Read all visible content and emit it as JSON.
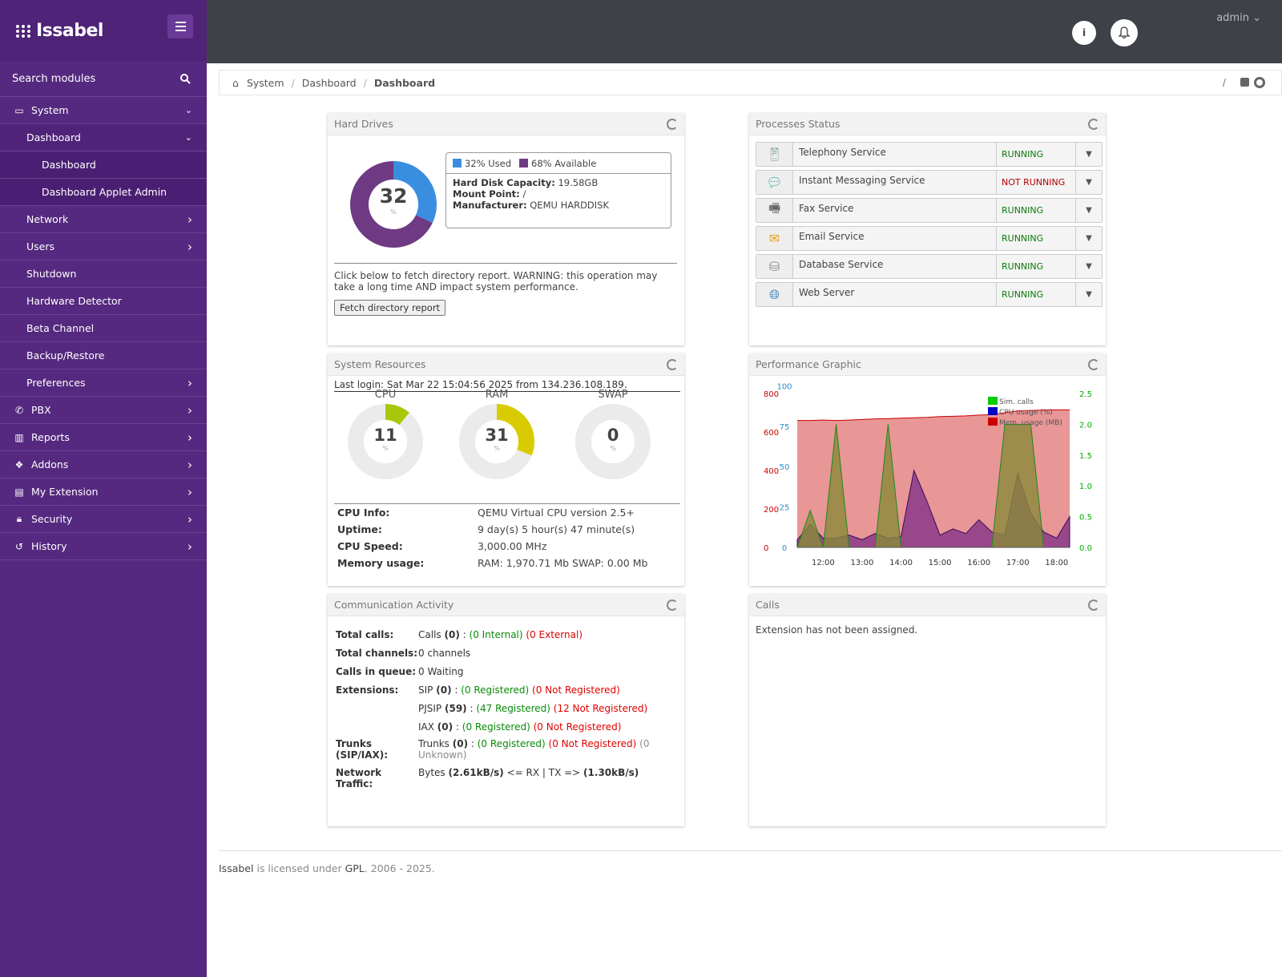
{
  "app": {
    "name": "Issabel",
    "user": "admin"
  },
  "sidebar": {
    "search": "Search modules",
    "items": [
      {
        "label": "System",
        "icon": "laptop-icon",
        "level": 0,
        "chevron": "down"
      },
      {
        "label": "Dashboard",
        "level": 1,
        "chevron": "down"
      },
      {
        "label": "Dashboard",
        "level": 2
      },
      {
        "label": "Dashboard Applet Admin",
        "level": 2
      },
      {
        "label": "Network",
        "level": 1,
        "chevron": "right"
      },
      {
        "label": "Users",
        "level": 1,
        "chevron": "right"
      },
      {
        "label": "Shutdown",
        "level": 1
      },
      {
        "label": "Hardware Detector",
        "level": 1
      },
      {
        "label": "Beta Channel",
        "level": 1
      },
      {
        "label": "Backup/Restore",
        "level": 1
      },
      {
        "label": "Preferences",
        "level": 1,
        "chevron": "right"
      },
      {
        "label": "PBX",
        "icon": "phone-icon",
        "level": 0,
        "chevron": "right"
      },
      {
        "label": "Reports",
        "icon": "bar-chart-icon",
        "level": 0,
        "chevron": "right"
      },
      {
        "label": "Addons",
        "icon": "cubes-icon",
        "level": 0,
        "chevron": "right"
      },
      {
        "label": "My Extension",
        "icon": "id-card-icon",
        "level": 0,
        "chevron": "right"
      },
      {
        "label": "Security",
        "icon": "lock-icon",
        "level": 0,
        "chevron": "right"
      },
      {
        "label": "History",
        "icon": "history-icon",
        "level": 0,
        "chevron": "right"
      }
    ]
  },
  "breadcrumb": [
    "System",
    "Dashboard",
    "Dashboard"
  ],
  "hard_drives": {
    "title": "Hard Drives",
    "used_percent": 32,
    "percent_sign": "%",
    "legend_used": "32% Used",
    "legend_available": "68% Available",
    "capacity_label": "Hard Disk Capacity:",
    "capacity": "19.58GB",
    "mount_label": "Mount Point:",
    "mount": "/",
    "manufacturer_label": "Manufacturer:",
    "manufacturer": "QEMU HARDDISK",
    "warning": "Click below to fetch directory report. WARNING: this operation may take a long time AND impact system performance.",
    "fetch_button": "Fetch directory report",
    "colors": {
      "used": "#3a8ee0",
      "available": "#6f3a84"
    }
  },
  "processes": {
    "title": "Processes Status",
    "items": [
      {
        "name": "Telephony Service",
        "status": "RUNNING",
        "running": true,
        "icon": "phone-device-icon"
      },
      {
        "name": "Instant Messaging Service",
        "status": "NOT RUNNING",
        "running": false,
        "icon": "chat-bubbles-icon"
      },
      {
        "name": "Fax Service",
        "status": "RUNNING",
        "running": true,
        "icon": "fax-icon"
      },
      {
        "name": "Email Service",
        "status": "RUNNING",
        "running": true,
        "icon": "envelope-icon"
      },
      {
        "name": "Database Service",
        "status": "RUNNING",
        "running": true,
        "icon": "database-icon"
      },
      {
        "name": "Web Server",
        "status": "RUNNING",
        "running": true,
        "icon": "globe-icon"
      }
    ]
  },
  "system_resources": {
    "title": "System Resources",
    "last_login": "Last login: Sat Mar 22 15:04:56 2025 from 134.236.108.189.",
    "gauges": [
      {
        "label": "CPU",
        "value": 11,
        "color": "#a8c70a"
      },
      {
        "label": "RAM",
        "value": 31,
        "color": "#d8cc00"
      },
      {
        "label": "SWAP",
        "value": 0,
        "color": "#d8cc00"
      }
    ],
    "percent_sign": "%",
    "info": [
      {
        "k": "CPU Info:",
        "v": "QEMU Virtual CPU version 2.5+"
      },
      {
        "k": "Uptime:",
        "v": "9 day(s) 5 hour(s) 47 minute(s)"
      },
      {
        "k": "CPU Speed:",
        "v": "3,000.00 MHz"
      },
      {
        "k": "Memory usage:",
        "v": "RAM: 1,970.71 Mb SWAP: 0.00 Mb"
      }
    ]
  },
  "performance": {
    "title": "Performance Graphic"
  },
  "chart_data": {
    "type": "area",
    "x": [
      "11:20",
      "11:40",
      "12:00",
      "12:20",
      "12:40",
      "13:00",
      "13:20",
      "13:40",
      "14:00",
      "14:20",
      "14:40",
      "15:00",
      "15:20",
      "15:40",
      "16:00",
      "16:20",
      "16:40",
      "17:00",
      "17:20",
      "17:40",
      "18:00",
      "18:20"
    ],
    "x_ticks": [
      "12:00",
      "13:00",
      "14:00",
      "15:00",
      "16:00",
      "17:00",
      "18:00"
    ],
    "y_left_ticks": [
      0,
      200,
      400,
      600,
      800
    ],
    "y_left_blue_ticks": [
      0,
      25,
      50,
      75,
      100
    ],
    "y_right_ticks": [
      "0.0",
      "0.5",
      "1.0",
      "1.5",
      "2.0",
      "2.5"
    ],
    "ylim_left": [
      0,
      800
    ],
    "ylim_blue": [
      0,
      100
    ],
    "ylim_right": [
      0,
      2.5
    ],
    "legend_position": "top-right",
    "series": [
      {
        "name": "Sim. calls",
        "color": "#00cc00",
        "axis": "right",
        "values": [
          0,
          0.6,
          0,
          2.0,
          0,
          0,
          0,
          2.0,
          0,
          0,
          0,
          0,
          0,
          0,
          0,
          0,
          2.0,
          2.0,
          2.0,
          0,
          0,
          0
        ]
      },
      {
        "name": "CPU usage (%)",
        "color": "#0000cc",
        "axis": "blue",
        "values": [
          5,
          15,
          6,
          6,
          8,
          5,
          9,
          6,
          7,
          50,
          30,
          8,
          12,
          9,
          18,
          10,
          8,
          48,
          22,
          10,
          6,
          20
        ]
      },
      {
        "name": "Mem. usage (MB)",
        "color": "#cc0000",
        "axis": "left",
        "values": [
          660,
          660,
          662,
          660,
          662,
          665,
          668,
          670,
          672,
          674,
          676,
          680,
          682,
          684,
          688,
          690,
          700,
          710,
          712,
          714,
          715,
          715
        ]
      }
    ]
  },
  "communication": {
    "title": "Communication Activity",
    "total_calls_label": "Total calls:",
    "total_calls": {
      "prefix": "Calls",
      "count": "(0)",
      "colon": ":",
      "internal": "(0 Internal)",
      "external": "(0 External)"
    },
    "total_channels_label": "Total channels:",
    "total_channels": "0 channels",
    "queue_label": "Calls in queue:",
    "queue": "0 Waiting",
    "extensions_label": "Extensions:",
    "extensions": [
      {
        "type": "SIP",
        "count": "(0)",
        "reg": "(0 Registered)",
        "unreg": "(0 Not Registered)"
      },
      {
        "type": "PJSIP",
        "count": "(59)",
        "reg": "(47 Registered)",
        "unreg": "(12 Not Registered)"
      },
      {
        "type": "IAX",
        "count": "(0)",
        "reg": "(0 Registered)",
        "unreg": "(0 Not Registered)"
      }
    ],
    "trunks_label": "Trunks (SIP/IAX):",
    "trunks": {
      "type": "Trunks",
      "count": "(0)",
      "reg": "(0 Registered)",
      "unreg": "(0 Not Registered)",
      "unknown": "(0 Unknown)"
    },
    "traffic_label": "Network Traffic:",
    "traffic": {
      "prefix": "Bytes",
      "rx": "(2.61kB/s)",
      "mid": "<= RX | TX =>",
      "tx": "(1.30kB/s)"
    }
  },
  "calls": {
    "title": "Calls",
    "message": "Extension has not been assigned."
  },
  "footer": {
    "brand": "Issabel",
    "text1": "is licensed under",
    "license": "GPL",
    "years": ". 2006 - 2025."
  }
}
